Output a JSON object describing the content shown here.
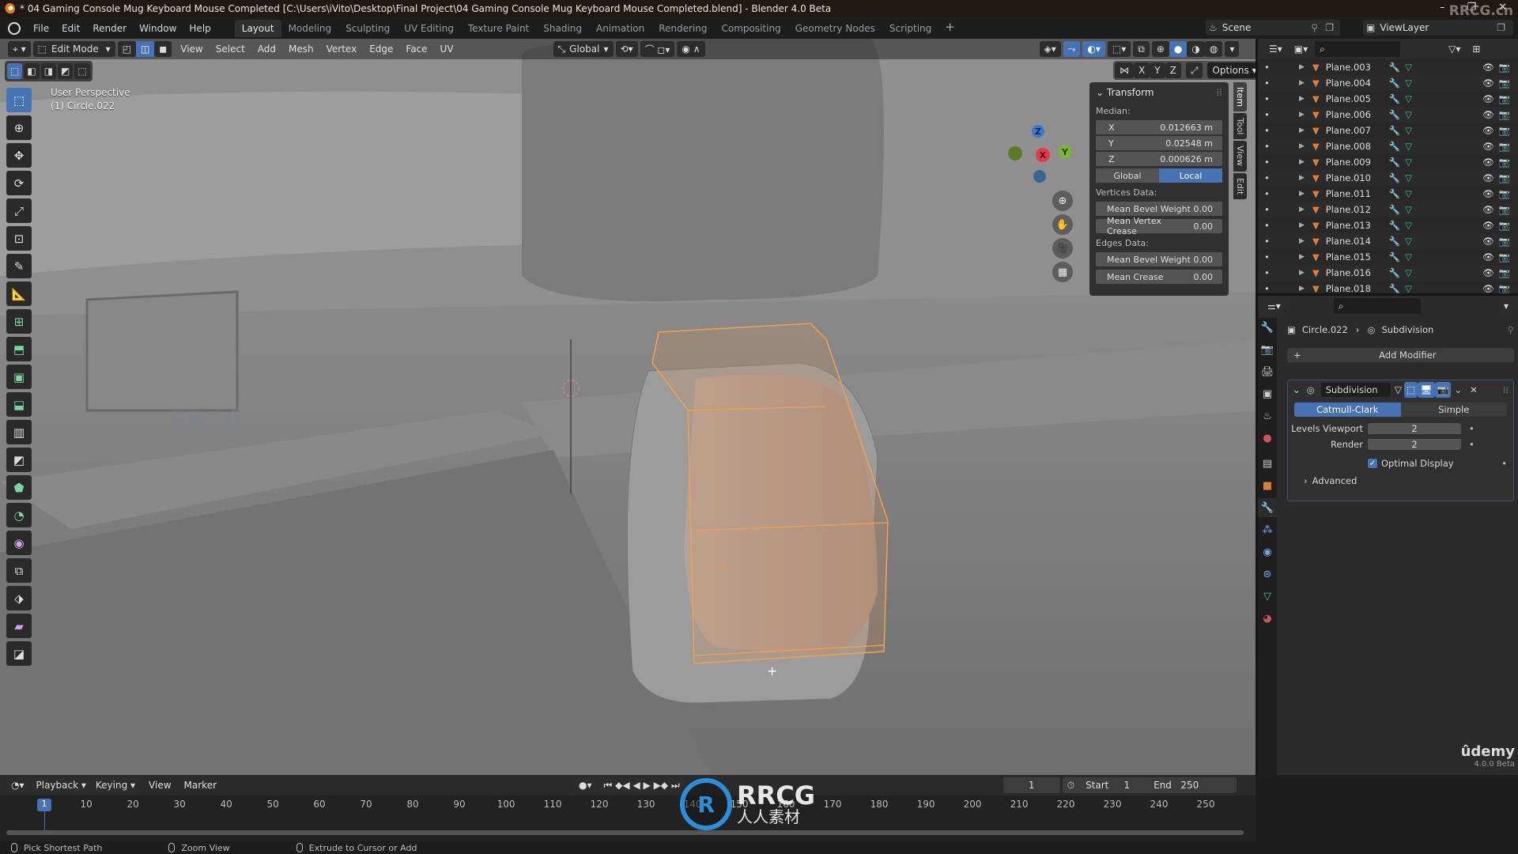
{
  "window": {
    "title": "* 04 Gaming Console Mug Keyboard Mouse Completed [C:\\Users\\iVito\\Desktop\\Final Project\\04 Gaming Console Mug Keyboard Mouse Completed.blend] - Blender 4.0 Beta",
    "controls": [
      "–",
      "❐",
      "✕"
    ]
  },
  "watermark": {
    "top": "RRCG.cn",
    "center_brand": "RRCG",
    "center_sub": "人人素材",
    "udemy": "ûdemy",
    "version": "4.0.0 Beta"
  },
  "menu": [
    "File",
    "Edit",
    "Render",
    "Window",
    "Help"
  ],
  "workspaces": {
    "active": "Layout",
    "tabs": [
      "Layout",
      "Modeling",
      "Sculpting",
      "UV Editing",
      "Texture Paint",
      "Shading",
      "Animation",
      "Rendering",
      "Compositing",
      "Geometry Nodes",
      "Scripting"
    ],
    "add": "+"
  },
  "scene": {
    "label": "Scene",
    "view_layer": "ViewLayer"
  },
  "viewport": {
    "mode": "Edit Mode",
    "menus": [
      "View",
      "Select",
      "Add",
      "Mesh",
      "Vertex",
      "Edge",
      "Face",
      "UV"
    ],
    "orientation": "Global",
    "options_label": "Options",
    "axes": [
      "X",
      "Y",
      "Z"
    ],
    "perspective": "User Perspective",
    "object_info": "(1) Circle.022",
    "gizmo": {
      "x": "X",
      "y": "Y",
      "z": "Z"
    },
    "nav_icons": [
      "zoom-icon",
      "hand-pan-icon",
      "camera-icon",
      "grid-ortho-icon"
    ]
  },
  "toolbar": {
    "tools": [
      {
        "name": "select-box",
        "glyph": "⬚",
        "active": true
      },
      {
        "name": "cursor",
        "glyph": "⊕"
      },
      {
        "name": "move",
        "glyph": "✥"
      },
      {
        "name": "rotate",
        "glyph": "⟳"
      },
      {
        "name": "scale",
        "glyph": "⤢"
      },
      {
        "name": "transform",
        "glyph": "⊡"
      },
      {
        "name": "annotate",
        "glyph": "✎"
      },
      {
        "name": "measure",
        "glyph": "📐"
      },
      {
        "name": "add-cube",
        "glyph": "⊞"
      },
      {
        "name": "extrude-region",
        "glyph": "⬒"
      },
      {
        "name": "inset-faces",
        "glyph": "▣"
      },
      {
        "name": "bevel",
        "glyph": "⬓"
      },
      {
        "name": "loop-cut",
        "glyph": "▥"
      },
      {
        "name": "knife",
        "glyph": "◩"
      },
      {
        "name": "poly-build",
        "glyph": "⬟"
      },
      {
        "name": "spin",
        "glyph": "◔"
      },
      {
        "name": "smooth",
        "glyph": "◉"
      },
      {
        "name": "edge-slide",
        "glyph": "⧉"
      },
      {
        "name": "shrink-fatten",
        "glyph": "⬗"
      },
      {
        "name": "shear",
        "glyph": "▰"
      },
      {
        "name": "rip-region",
        "glyph": "◪"
      }
    ]
  },
  "npanel": {
    "title": "Transform",
    "median_label": "Median:",
    "median": [
      {
        "axis": "X",
        "value": "0.012663 m"
      },
      {
        "axis": "Y",
        "value": "0.02548 m"
      },
      {
        "axis": "Z",
        "value": "0.000626 m"
      }
    ],
    "space_toggle": {
      "options": [
        "Global",
        "Local"
      ],
      "active": "Local"
    },
    "vertices_label": "Vertices Data:",
    "vertices": [
      {
        "label": "Mean Bevel Weight",
        "value": "0.00"
      },
      {
        "label": "Mean Vertex Crease",
        "value": "0.00"
      }
    ],
    "edges_label": "Edges Data:",
    "edges": [
      {
        "label": "Mean Bevel Weight",
        "value": "0.00"
      },
      {
        "label": "Mean Crease",
        "value": "0.00"
      }
    ],
    "tabs": [
      "Item",
      "Tool",
      "View",
      "Edit"
    ],
    "active_tab": "Item"
  },
  "outliner": {
    "search_placeholder": "",
    "rows": [
      "Plane.003",
      "Plane.004",
      "Plane.005",
      "Plane.006",
      "Plane.007",
      "Plane.008",
      "Plane.009",
      "Plane.010",
      "Plane.011",
      "Plane.012",
      "Plane.013",
      "Plane.014",
      "Plane.015",
      "Plane.016",
      "Plane.018"
    ]
  },
  "properties": {
    "breadcrumb_object": "Circle.022",
    "breadcrumb_modifier": "Subdivision",
    "add_modifier": "Add Modifier",
    "modifier": {
      "name": "Subdivision",
      "type_options": [
        "Catmull-Clark",
        "Simple"
      ],
      "type_active": "Catmull-Clark",
      "levels_viewport_label": "Levels Viewport",
      "levels_viewport": "2",
      "render_label": "Render",
      "render": "2",
      "optimal_display_label": "Optimal Display",
      "optimal_display": true,
      "advanced_label": "Advanced"
    }
  },
  "timeline": {
    "menus": [
      "Playback",
      "Keying",
      "View",
      "Marker"
    ],
    "current_frame": "1",
    "start_label": "Start",
    "start": "1",
    "end_label": "End",
    "end": "250",
    "ruler": [
      "10",
      "20",
      "30",
      "40",
      "50",
      "60",
      "70",
      "80",
      "90",
      "100",
      "110",
      "120",
      "130",
      "140",
      "150",
      "160",
      "170",
      "180",
      "190",
      "200",
      "210",
      "220",
      "230",
      "240",
      "250"
    ]
  },
  "statusbar": [
    {
      "label": "Pick Shortest Path"
    },
    {
      "label": "Zoom View"
    },
    {
      "label": "Extrude to Cursor or Add"
    }
  ],
  "colors": {
    "accent": "#4772b3",
    "selection": "#e8a050",
    "object_orange": "#d9803a"
  }
}
